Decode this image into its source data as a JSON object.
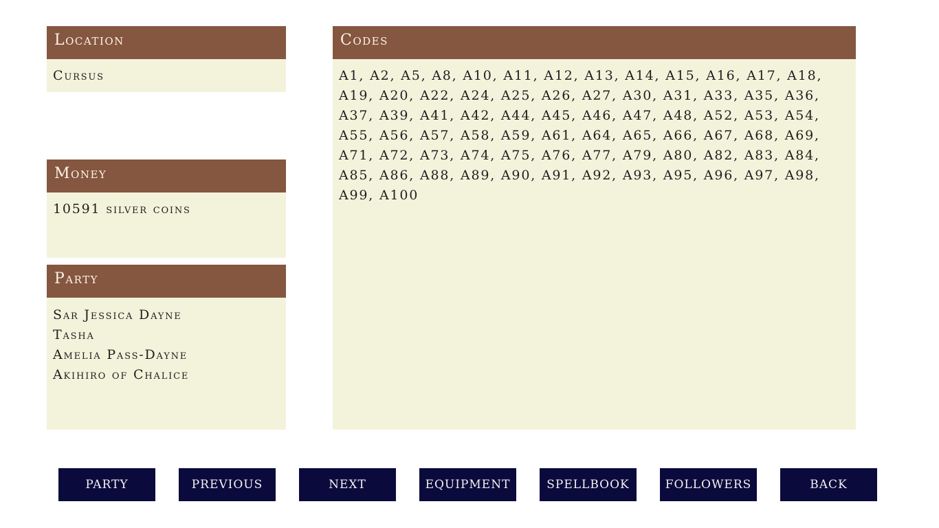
{
  "location": {
    "title": "Location",
    "value": "Cursus"
  },
  "money": {
    "title": "Money",
    "value": "10591 silver coins"
  },
  "party": {
    "title": "Party",
    "members": [
      "Sar Jessica Dayne",
      "Tasha",
      "Amelia Pass-Dayne",
      "Akihiro of Chalice"
    ]
  },
  "codes": {
    "title": "Codes",
    "text": "A1, A2, A5, A8, A10, A11, A12, A13, A14, A15, A16, A17, A18, A19, A20, A22, A24, A25, A26, A27, A30, A31, A33, A35, A36, A37, A39, A41, A42, A44, A45, A46, A47, A48, A52, A53, A54, A55, A56, A57, A58, A59, A61, A64, A65, A66, A67, A68, A69, A71, A72, A73, A74, A75, A76, A77, A79, A80, A82, A83, A84, A85, A86, A88, A89, A90, A91, A92, A93, A95, A96, A97, A98, A99, A100"
  },
  "nav": {
    "party": "PARTY",
    "previous": "PREVIOUS",
    "next": "NEXT",
    "equipment": "EQUIPMENT",
    "spellbook": "SPELLBOOK",
    "followers": "FOLLOWERS",
    "back": "BACK"
  },
  "colors": {
    "header_bg": "#855640",
    "panel_bg": "#f3f3dc",
    "button_bg": "#0b0a3c",
    "button_text": "#f2f2f2"
  }
}
